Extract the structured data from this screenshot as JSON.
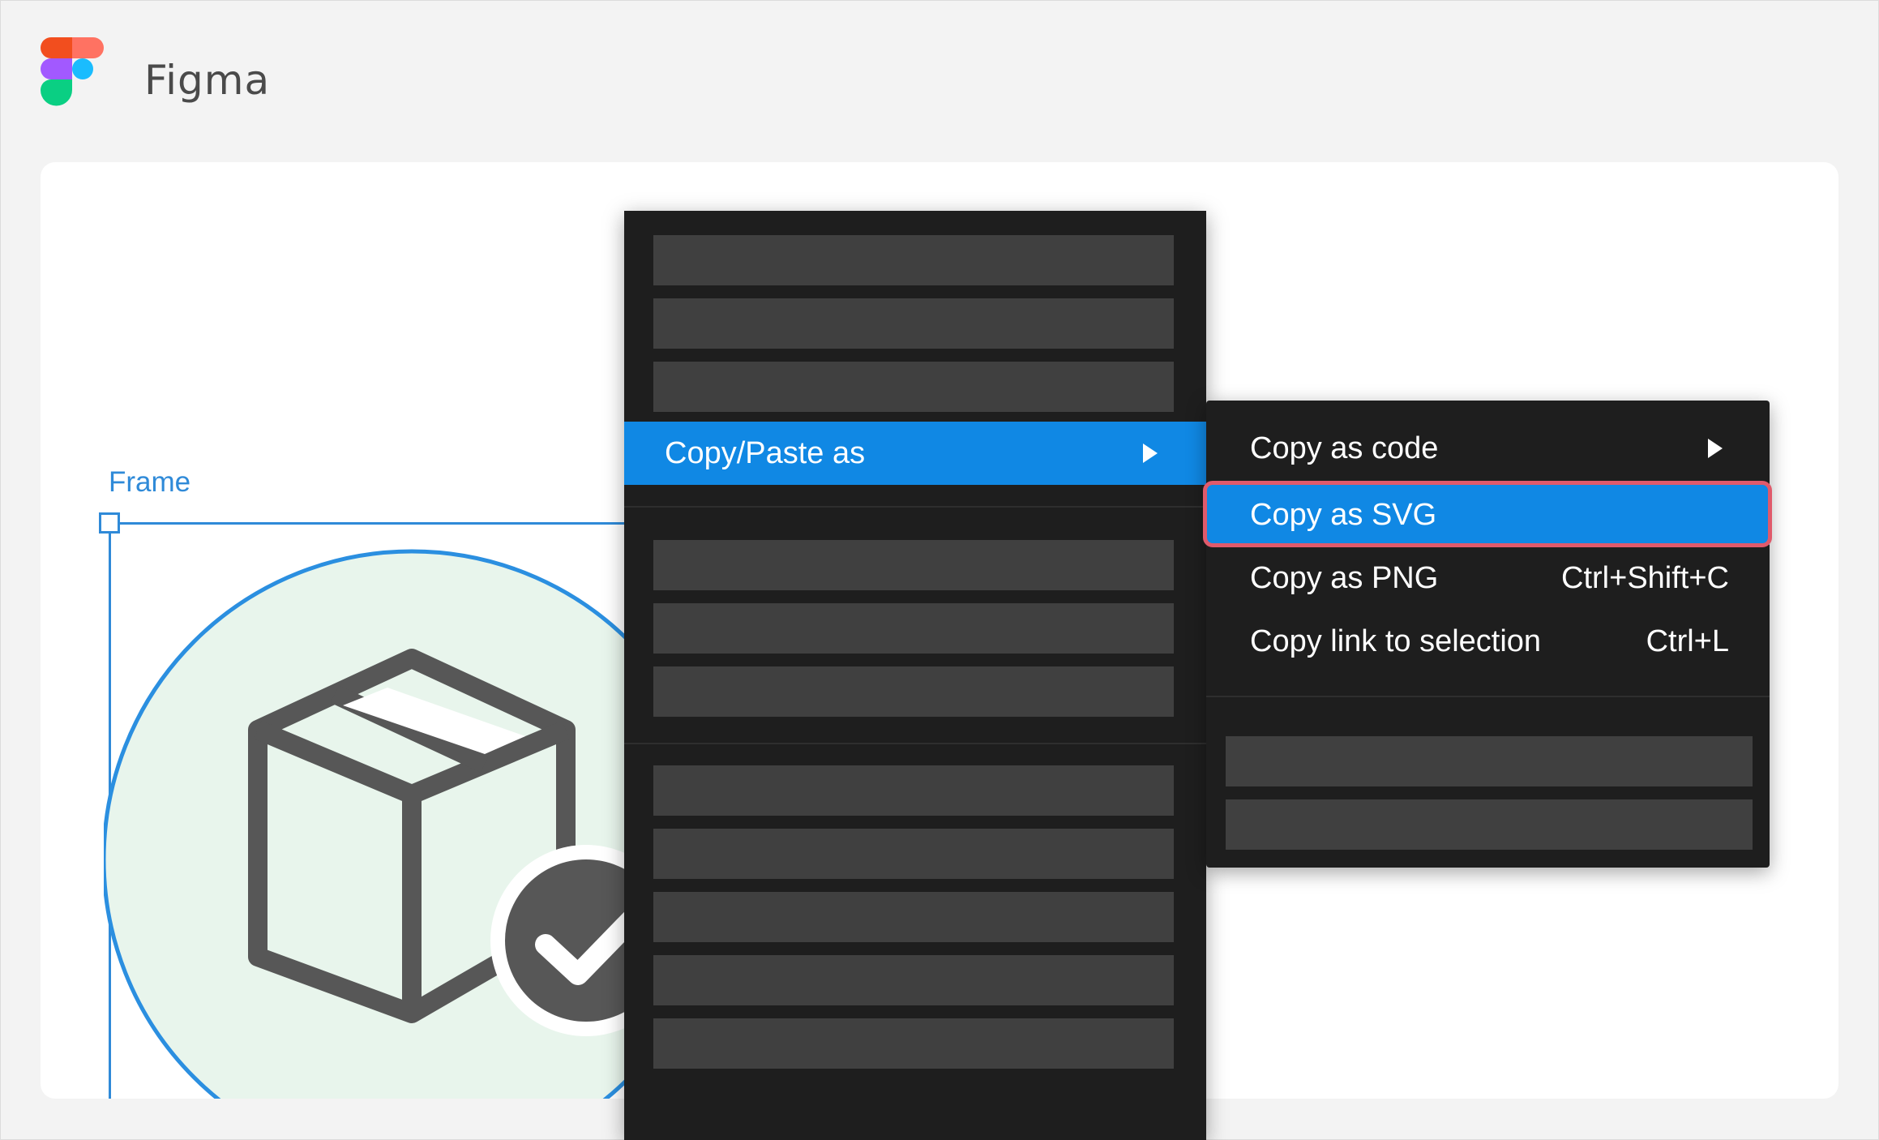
{
  "app": {
    "name": "Figma"
  },
  "canvas": {
    "frame_label": "Frame"
  },
  "context_menu": {
    "active_item": {
      "label": "Copy/Paste as"
    },
    "placeholder_rows_above": 3,
    "placeholder_rows_group2": 3,
    "placeholder_rows_group3": 5
  },
  "submenu": {
    "items": [
      {
        "label": "Copy as code",
        "shortcut": "",
        "has_submenu": true
      },
      {
        "label": "Copy as SVG",
        "shortcut": "",
        "highlighted": true
      },
      {
        "label": "Copy as PNG",
        "shortcut": "Ctrl+Shift+C"
      },
      {
        "label": "Copy link to selection",
        "shortcut": "Ctrl+L"
      }
    ],
    "placeholder_rows_below": 2
  },
  "colors": {
    "accent": "#1088e4",
    "menu_background": "#1e1e1e",
    "placeholder": "#404040",
    "selection_frame": "#2f8ad8",
    "callout": "#e05a6b"
  },
  "icons": [
    "figma-logo-icon",
    "package-check-icon",
    "chevron-right-icon"
  ]
}
